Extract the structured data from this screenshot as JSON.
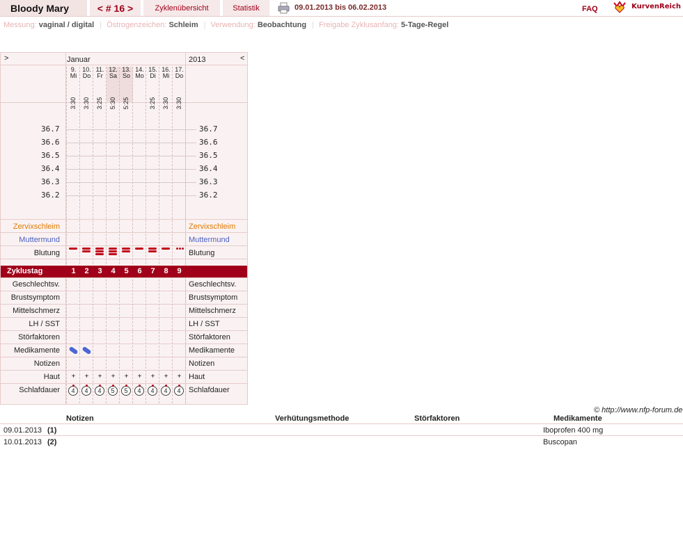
{
  "header": {
    "user_name": "Bloody Mary",
    "cycle_label": "< # 16 >",
    "overview_tab": "Zyklenübersicht",
    "stats_tab": "Statistik",
    "print_icon": "printer-icon",
    "date_range": "09.01.2013 bis 06.02.2013",
    "faq": "FAQ",
    "logo_text": "KurvenReich",
    "logo_icon": "crown-heart-icon",
    "accent_color": "#a0001a"
  },
  "settings": {
    "measure_key": "Messung:",
    "measure_val": "vaginal / digital",
    "estrogen_key": "Östrogenzeichen:",
    "estrogen_val": "Schleim",
    "usage_key": "Verwendung:",
    "usage_val": "Beobachtung",
    "release_key": "Freigabe Zyklusanfang:",
    "release_val": "5-Tage-Regel"
  },
  "chart": {
    "nav_left": ">",
    "nav_right": "<",
    "month": "Januar",
    "year": "2013",
    "days": [
      {
        "date": "9.",
        "weekday": "Mi",
        "time": "3:30"
      },
      {
        "date": "10.",
        "weekday": "Do",
        "time": "3:30"
      },
      {
        "date": "11.",
        "weekday": "Fr",
        "time": "3:25"
      },
      {
        "date": "12.",
        "weekday": "Sa",
        "time": "5:30"
      },
      {
        "date": "13.",
        "weekday": "So",
        "time": "5:25"
      },
      {
        "date": "14.",
        "weekday": "Mo",
        "time": ""
      },
      {
        "date": "15.",
        "weekday": "Di",
        "time": "3:25"
      },
      {
        "date": "16.",
        "weekday": "Mi",
        "time": "3:30"
      },
      {
        "date": "17.",
        "weekday": "Do",
        "time": "3:30"
      }
    ],
    "temps": [
      "36.7",
      "36.6",
      "36.5",
      "36.4",
      "36.3",
      "36.2"
    ],
    "rows": {
      "zervix": "Zervixschleim",
      "mutter": "Muttermund",
      "blutung": "Blutung",
      "zyklustag": "Zyklustag",
      "geschlechtsv": "Geschlechtsv.",
      "brust": "Brustsymptom",
      "mittel": "Mittelschmerz",
      "lh": "LH / SST",
      "stoer": "Störfaktoren",
      "medi": "Medikamente",
      "notizen": "Notizen",
      "haut": "Haut",
      "schlaf": "Schlafdauer"
    },
    "cycle_days": [
      "1",
      "2",
      "3",
      "4",
      "5",
      "6",
      "7",
      "8",
      "9"
    ],
    "bleeding_levels": [
      1,
      2,
      3,
      3,
      2,
      1,
      2,
      1,
      0.5
    ],
    "medication_days": [
      1,
      2
    ],
    "skin": [
      "+",
      "+",
      "+",
      "+",
      "+",
      "+",
      "+",
      "+",
      "+"
    ],
    "sleep_hours": [
      "4",
      "4",
      "4",
      "5",
      "5",
      "4",
      "4",
      "4",
      "4"
    ],
    "pill_icon": "pill-icon",
    "sleep_icon": "clock-icon"
  },
  "copyright": "© http://www.nfp-forum.de",
  "notes_table": {
    "headers": {
      "notes": "Notizen",
      "method": "Verhütungsmethode",
      "disturb": "Störfaktoren",
      "meds": "Medikamente"
    },
    "rows": [
      {
        "date": "09.01.2013",
        "note": "(1)",
        "meds": "Iboprofen 400 mg"
      },
      {
        "date": "10.01.2013",
        "note": "(2)",
        "meds": "Buscopan"
      }
    ]
  }
}
